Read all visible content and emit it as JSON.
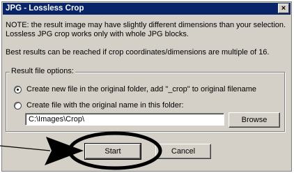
{
  "window": {
    "title": "JPG - Lossless Crop",
    "close_label": "×"
  },
  "messages": {
    "note": "NOTE: the result image may have slightly different dimensions than your selection. Lossless JPG crop works only with whole JPG blocks.",
    "best": "Best results can be reached if crop coordinates/dimensions are multiple of 16."
  },
  "result_options": {
    "legend": "Result file options:",
    "option_new_file": "Create new file in the original folder, add \"_crop\" to original filename",
    "option_folder": "Create file with the original name in this folder:",
    "selected": "option_new_file",
    "folder_value": "C:\\Images\\Crop\\"
  },
  "buttons": {
    "browse": "Browse",
    "start": "Start",
    "cancel": "Cancel"
  },
  "colors": {
    "titlebar": "#0a246a",
    "dialog_face": "#d4d0c8",
    "annotation": "#000000"
  },
  "icons": {
    "annotation_arrow": "arrow-right-icon",
    "annotation_circle": "ellipse-highlight-icon"
  }
}
